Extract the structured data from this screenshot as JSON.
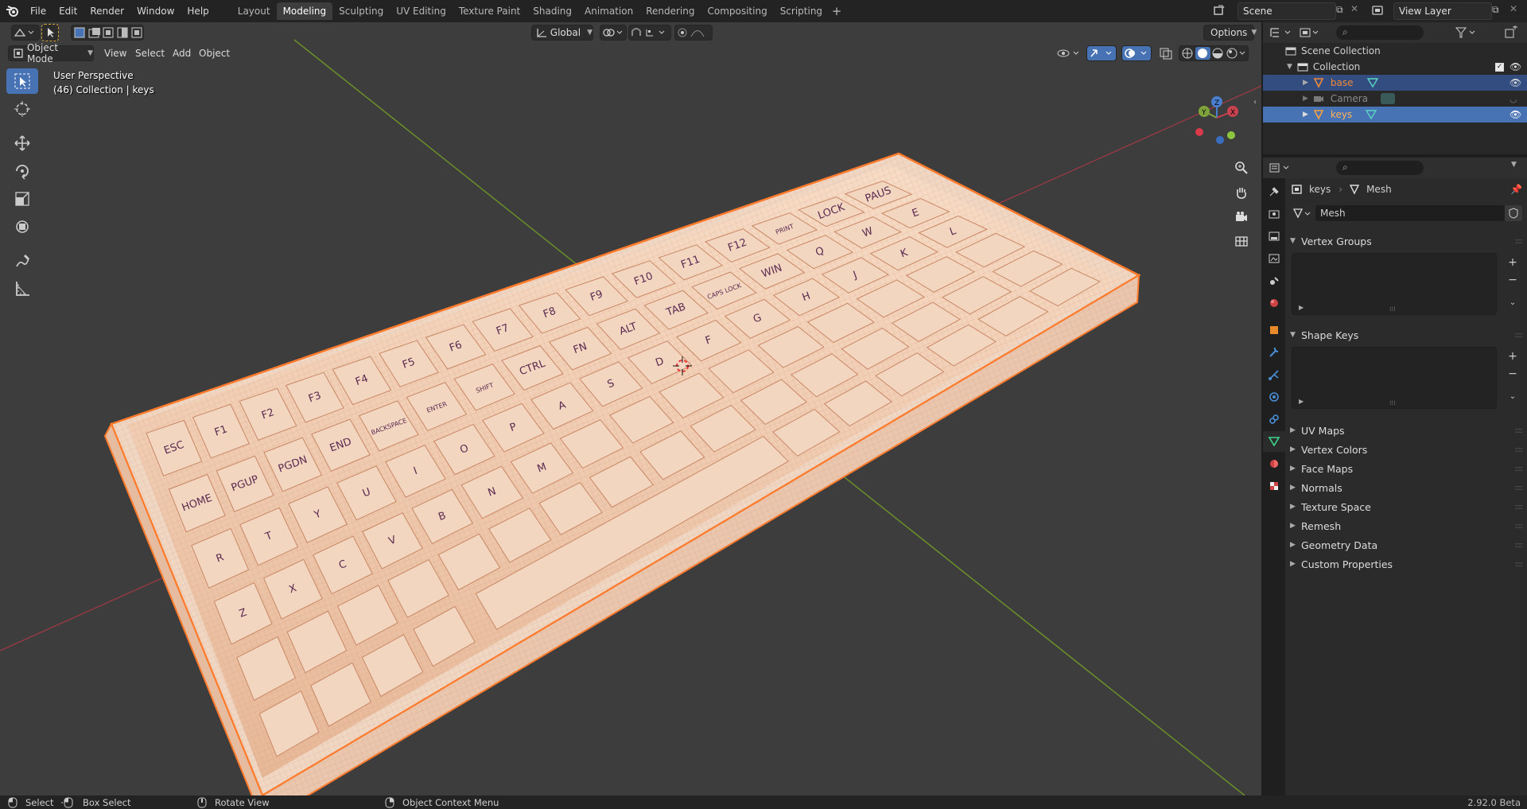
{
  "topbar": {
    "menus": [
      "File",
      "Edit",
      "Render",
      "Window",
      "Help"
    ],
    "workspaces": [
      "Layout",
      "Modeling",
      "Sculpting",
      "UV Editing",
      "Texture Paint",
      "Shading",
      "Animation",
      "Rendering",
      "Compositing",
      "Scripting"
    ],
    "active_workspace": "Modeling",
    "scene_name": "Scene",
    "view_layer": "View Layer"
  },
  "viewport": {
    "mode": "Object Mode",
    "menus": [
      "View",
      "Select",
      "Add",
      "Object"
    ],
    "orientation": "Global",
    "options_label": "Options",
    "overlay_line1": "User Perspective",
    "overlay_line2": "(46) Collection | keys",
    "gizmo_labels": {
      "x": "X",
      "y": "Y",
      "z": "Z"
    },
    "keycaps": [
      "ESC",
      "F1",
      "F2",
      "F3",
      "F4",
      "F5",
      "F6",
      "F7",
      "F8",
      "F9",
      "F10",
      "F11",
      "F12",
      "PRINT",
      "LOCK",
      "PAUS",
      "HOME",
      "PGUP",
      "PGDN",
      "END",
      "BACKSPACE",
      "ENTER",
      "SHIFT",
      "CTRL",
      "FN",
      "ALT",
      "TAB",
      "CAPS LOCK",
      "WIN",
      "Q",
      "W",
      "E",
      "R",
      "T",
      "Y",
      "U",
      "I",
      "O",
      "P",
      "A",
      "S",
      "D",
      "F",
      "G",
      "H",
      "J",
      "K",
      "L",
      "Z",
      "X",
      "C",
      "V",
      "B",
      "N",
      "M"
    ]
  },
  "outliner": {
    "root": "Scene Collection",
    "collection": "Collection",
    "items": [
      {
        "name": "base",
        "selected": true,
        "color": "#f08a3a"
      },
      {
        "name": "Camera",
        "selected": false,
        "color": "#8a8a8a"
      },
      {
        "name": "keys",
        "selected": true,
        "color": "#f5a040"
      }
    ]
  },
  "properties": {
    "breadcrumb_object": "keys",
    "breadcrumb_data": "Mesh",
    "mesh_name": "Mesh",
    "panels_open": [
      "Vertex Groups",
      "Shape Keys"
    ],
    "panels_closed": [
      "UV Maps",
      "Vertex Colors",
      "Face Maps",
      "Normals",
      "Texture Space",
      "Remesh",
      "Geometry Data",
      "Custom Properties"
    ]
  },
  "statusbar": {
    "select": "Select",
    "box_select": "Box Select",
    "rotate": "Rotate View",
    "context": "Object Context Menu",
    "version": "2.92.0 Beta"
  },
  "colors": {
    "accent": "#4772b3",
    "selection_outline": "#f08a3a",
    "viewport_bg": "#3d3d3d",
    "keycap": "#f2cfb5"
  }
}
